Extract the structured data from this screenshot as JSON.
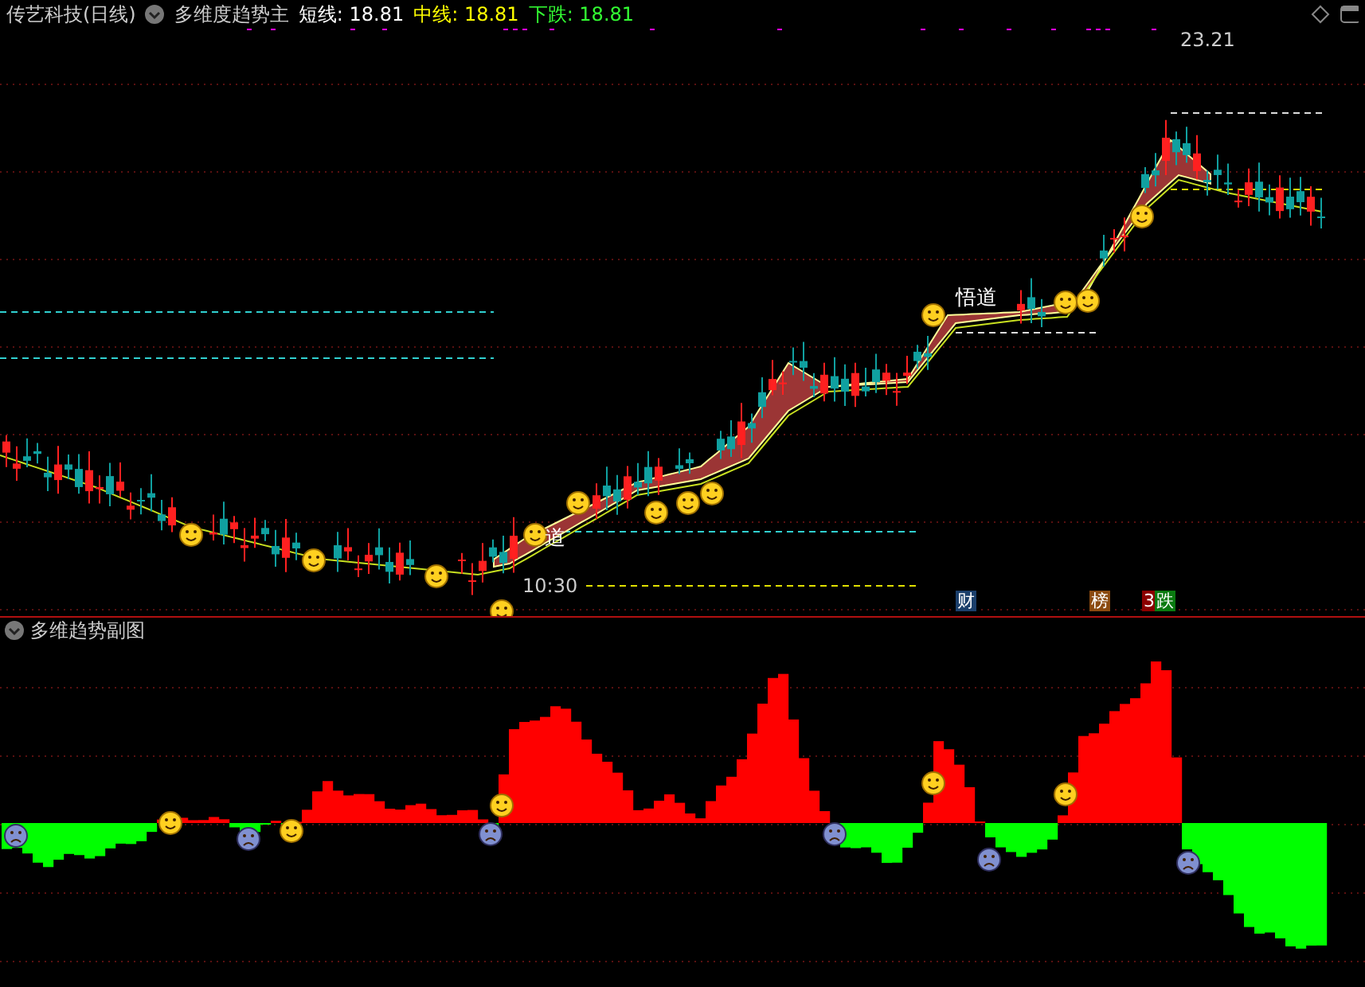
{
  "header": {
    "stock": "传艺科技(日线)",
    "indicator": "多维度趋势主",
    "lines": [
      {
        "label": "短线:",
        "value": "18.81",
        "color": "#ffffff"
      },
      {
        "label": "中线:",
        "value": "18.81",
        "color": "#ffff00"
      },
      {
        "label": "下跌:",
        "value": "18.81",
        "color": "#33ff33"
      }
    ]
  },
  "main_chart": {
    "price_label": "23.21",
    "time_label": "10:30",
    "labels": [
      {
        "text": "道"
      },
      {
        "text": "悟道"
      }
    ],
    "badges": [
      {
        "text": "财",
        "color": "#1b3f6b"
      },
      {
        "text": "榜",
        "color": "#8b4a10"
      },
      {
        "text": "3",
        "color": "#8b0000"
      },
      {
        "text": "跌",
        "color": "#0a7a10"
      }
    ]
  },
  "sub_chart": {
    "title": "多维趋势副图"
  }
}
